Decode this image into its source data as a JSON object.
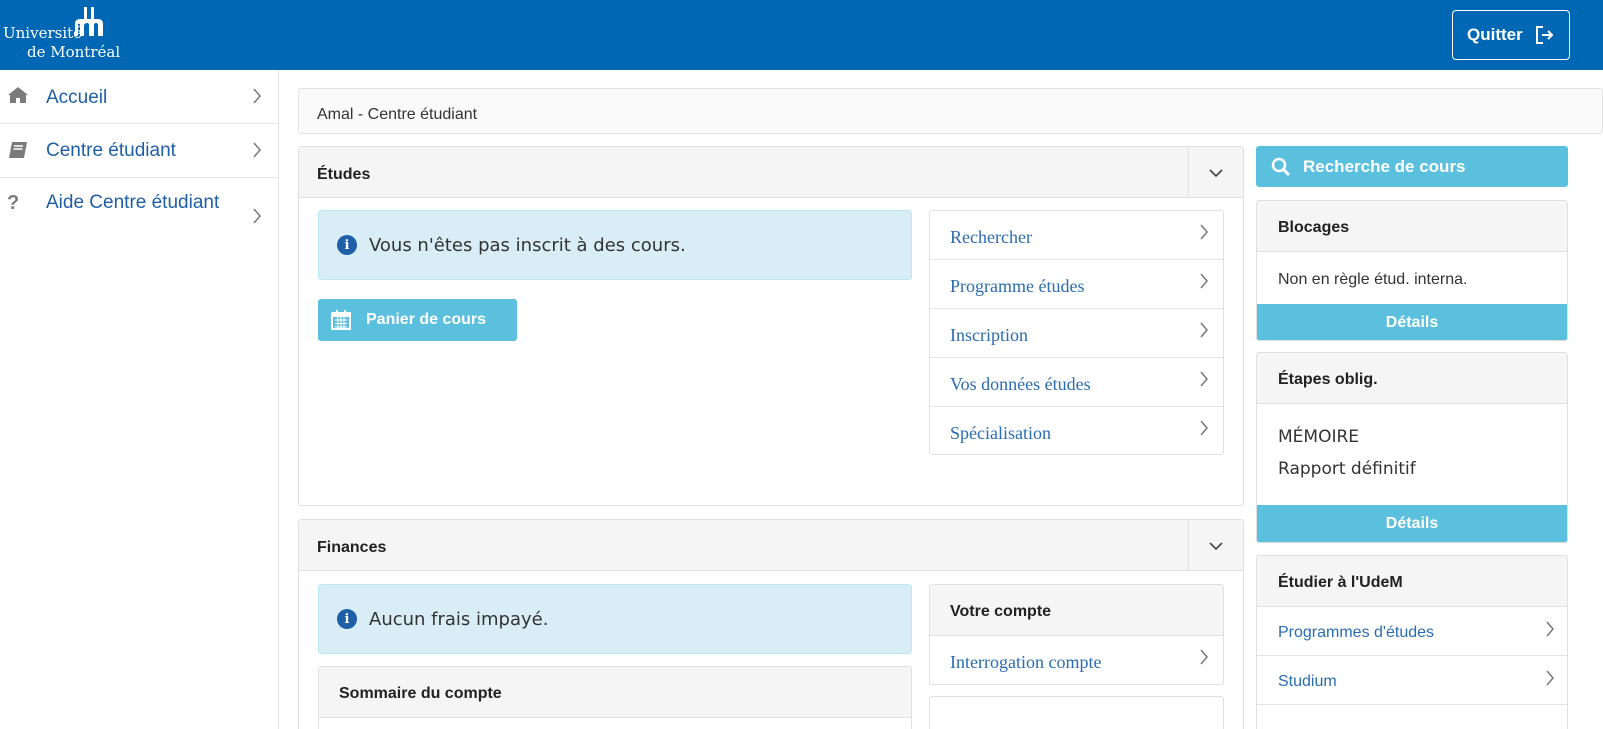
{
  "header": {
    "logo_line1": "Université",
    "logo_line2": "de Montréal",
    "quit_label": "Quitter",
    "quit_icon": "sign-out-icon",
    "bg_color": "#0067b4"
  },
  "sidebar": {
    "items": [
      {
        "label": "Accueil",
        "icon": "home-icon"
      },
      {
        "label": "Centre étudiant",
        "icon": "book-icon"
      },
      {
        "label": "Aide Centre étudiant",
        "icon": "question-icon"
      }
    ]
  },
  "breadcrumb": "Amal - Centre étudiant",
  "etudes": {
    "title": "Études",
    "alert": "Vous n'êtes pas inscrit à des cours.",
    "cart_button": "Panier de cours",
    "links": [
      "Rechercher",
      "Programme études",
      "Inscription",
      "Vos données études",
      "Spécialisation"
    ]
  },
  "finances": {
    "title": "Finances",
    "alert": "Aucun frais impayé.",
    "summary_title": "Sommaire du compte",
    "account_title": "Votre compte",
    "account_links": [
      "Interrogation compte"
    ]
  },
  "right": {
    "search_button": "Recherche de cours",
    "blocages": {
      "title": "Blocages",
      "text": "Non en règle étud. interna.",
      "details": "Détails"
    },
    "etapes": {
      "title": "Étapes oblig.",
      "line1": "MÉMOIRE",
      "line2": "Rapport définitif",
      "details": "Détails"
    },
    "etudier": {
      "title": "Étudier à l'UdeM",
      "links": [
        "Programmes d'études",
        "Studium"
      ]
    }
  },
  "colors": {
    "accent": "#5bc0de",
    "link": "#2a6cb0",
    "alert_bg": "#d9edf7"
  }
}
